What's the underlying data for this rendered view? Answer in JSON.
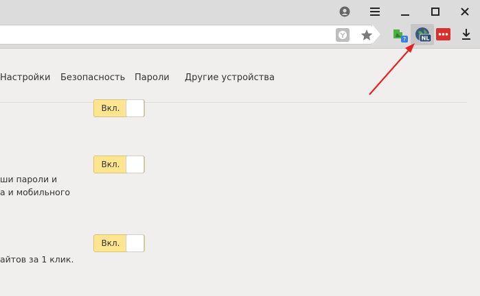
{
  "titlebar": {
    "profile_icon": "profile-icon",
    "menu_icon": "hamburger-menu-icon",
    "minimize_icon": "minimize-icon",
    "maximize_icon": "maximize-icon",
    "close_icon": "close-icon"
  },
  "addressbar": {
    "value": "",
    "protect_icon": "protect-shield-icon",
    "bookmark_icon": "star-icon"
  },
  "extensions": [
    {
      "name": "green-puzzle-extension-icon",
      "badge": "?"
    },
    {
      "name": "nl-globe-extension-icon",
      "badge": "NL"
    },
    {
      "name": "red-dots-extension-icon"
    },
    {
      "name": "download-icon"
    }
  ],
  "tabs": [
    {
      "label": "Настройки"
    },
    {
      "label": "Безопасность"
    },
    {
      "label": "Пароли"
    },
    {
      "label": "Другие устройства"
    }
  ],
  "settings": [
    {
      "toggle_label": "Вкл.",
      "description_lines": []
    },
    {
      "toggle_label": "Вкл.",
      "description_lines": [
        "ши пароли и",
        "а и мобильного"
      ]
    },
    {
      "toggle_label": "Вкл.",
      "description_lines": [
        "айтов за 1 клик."
      ]
    }
  ],
  "colors": {
    "toggle_on": "#ffe590",
    "annotation_arrow": "#e8201f",
    "nl_badge": "#2c4a6e",
    "ext_red": "#d8312d",
    "ext_green": "#4caf3e"
  }
}
